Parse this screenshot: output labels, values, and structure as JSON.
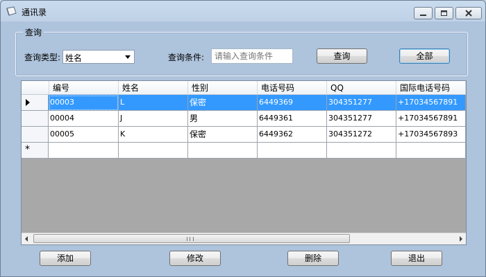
{
  "window": {
    "title": "通讯录"
  },
  "query": {
    "group_title": "查询",
    "type_label": "查询类型:",
    "type_value": "姓名",
    "condition_label": "查询条件:",
    "condition_placeholder": "请输入查询条件",
    "query_button": "查询",
    "all_button": "全部"
  },
  "grid": {
    "columns": [
      "编号",
      "姓名",
      "性别",
      "电话号码",
      "QQ",
      "国际电话号码"
    ],
    "rows": [
      [
        "00003",
        "L",
        "保密",
        "6449369",
        "304351277",
        "+17034567891"
      ],
      [
        "00004",
        "J",
        "男",
        "6449361",
        "304351277",
        "+17034567891"
      ],
      [
        "00005",
        "K",
        "保密",
        "6449362",
        "304351272",
        "+17034567893"
      ]
    ],
    "new_row_marker": "*"
  },
  "actions": {
    "add": "添加",
    "edit": "修改",
    "delete": "删除",
    "exit": "退出"
  }
}
